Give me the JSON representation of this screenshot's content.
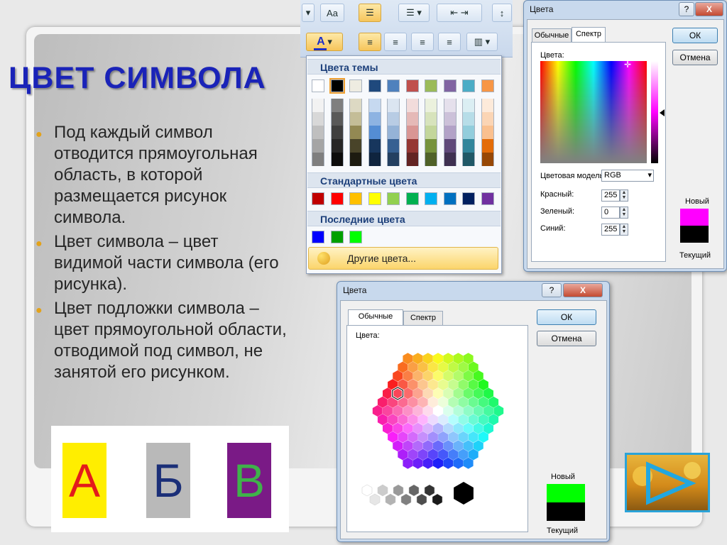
{
  "slide": {
    "title": "ЦВЕТ СИМВОЛА",
    "bullets": [
      "Под каждый символ отводится прямоугольная область, в которой размещается рисунок символа.",
      "Цвет символа – цвет видимой части символа (его рисунка).",
      "Цвет подложки символа – цвет прямоугольной области, отводимой под символ, не занятой его рисунком."
    ],
    "examples": [
      {
        "letter": "А",
        "color": "#e31b1b",
        "background": "#ffee00"
      },
      {
        "letter": "Б",
        "color": "#1b2f78",
        "background": "#b9b9b9"
      },
      {
        "letter": "В",
        "color": "#3fb24a",
        "background": "#7a1a86"
      }
    ],
    "accent_color": "#1a23b8",
    "next_button_icon": "play-arrow-icon"
  },
  "palette": {
    "font_color_icon": "A",
    "font_color_underline": "#1d2fc7",
    "theme_header": "Цвета темы",
    "standard_header": "Стандартные цвета",
    "recent_header": "Последние цвета",
    "more_colors": "Другие цвета...",
    "theme_top": [
      "#ffffff",
      "#000000",
      "#eeece1",
      "#1f497d",
      "#4f81bd",
      "#c0504d",
      "#9bbb59",
      "#8064a2",
      "#4bacc6",
      "#f79646"
    ],
    "theme_shades": [
      [
        "#f2f2f2",
        "#d8d8d8",
        "#bfbfbf",
        "#a5a5a5",
        "#7f7f7f"
      ],
      [
        "#7f7f7f",
        "#595959",
        "#3f3f3f",
        "#262626",
        "#0c0c0c"
      ],
      [
        "#ddd9c3",
        "#c4bd97",
        "#938953",
        "#494429",
        "#1d1b10"
      ],
      [
        "#c6d9f0",
        "#8db3e2",
        "#548dd4",
        "#17365d",
        "#0f243e"
      ],
      [
        "#dbe5f1",
        "#b8cce4",
        "#95b3d7",
        "#366092",
        "#244061"
      ],
      [
        "#f2dcdb",
        "#e5b9b7",
        "#d99694",
        "#953734",
        "#632423"
      ],
      [
        "#ebf1dd",
        "#d7e3bc",
        "#c3d69b",
        "#76923c",
        "#4f6128"
      ],
      [
        "#e5e0ec",
        "#ccc1d9",
        "#b2a2c7",
        "#5f497a",
        "#3f3151"
      ],
      [
        "#dbeef3",
        "#b7dde8",
        "#92cddc",
        "#31859b",
        "#205867"
      ],
      [
        "#fdeada",
        "#fbd5b5",
        "#fac08f",
        "#e36c09",
        "#974806"
      ]
    ],
    "standard": [
      "#c00000",
      "#ff0000",
      "#ffc000",
      "#ffff00",
      "#92d050",
      "#00b050",
      "#00b0f0",
      "#0070c0",
      "#002060",
      "#7030a0"
    ],
    "recent": [
      "#0000ff",
      "#00a000",
      "#00ff00"
    ]
  },
  "dialog_spectrum": {
    "title": "Цвета",
    "help": "?",
    "close": "X",
    "tabs": [
      "Обычные",
      "Спектр"
    ],
    "colors_label": "Цвета:",
    "model_label": "Цветовая модель:",
    "model_value": "RGB",
    "red_label": "Красный:",
    "red_value": "255",
    "green_label": "Зеленый:",
    "green_value": "0",
    "blue_label": "Синий:",
    "blue_value": "255",
    "ok": "ОК",
    "cancel": "Отмена",
    "new_label": "Новый",
    "current_label": "Текущий",
    "new_color": "#ff00ff",
    "current_color": "#000000"
  },
  "dialog_standard": {
    "title": "Цвета",
    "help": "?",
    "close": "X",
    "tabs": [
      "Обычные",
      "Спектр"
    ],
    "colors_label": "Цвета:",
    "ok": "ОК",
    "cancel": "Отмена",
    "new_label": "Новый",
    "current_label": "Текущий",
    "new_color": "#00ff00",
    "current_color": "#000000"
  }
}
